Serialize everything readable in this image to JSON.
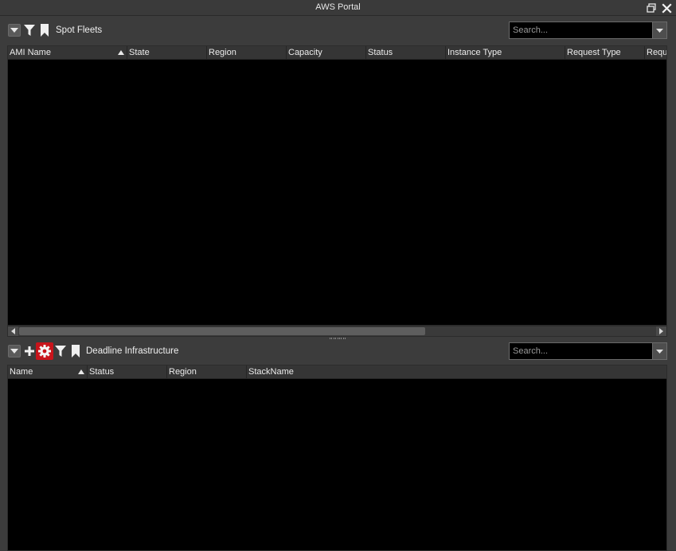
{
  "window": {
    "title": "AWS Portal"
  },
  "spot_fleets": {
    "label": "Spot Fleets",
    "search": {
      "placeholder": "Search...",
      "value": ""
    },
    "columns": [
      "AMI Name",
      "State",
      "Region",
      "Capacity",
      "Status",
      "Instance Type",
      "Request Type",
      "Requ"
    ],
    "sorted_column": "AMI Name",
    "rows": []
  },
  "deadline_infrastructure": {
    "label": "Deadline Infrastructure",
    "search": {
      "placeholder": "Search...",
      "value": ""
    },
    "columns": [
      "Name",
      "Status",
      "Region",
      "StackName"
    ],
    "sorted_column": "Name",
    "rows": []
  },
  "icons": {
    "restore": "restore-window-icon",
    "close": "close-icon",
    "dropdown": "chevron-down-icon",
    "filter": "filter-icon",
    "bookmark": "bookmark-icon",
    "add": "plus-icon",
    "settings": "gear-icon"
  },
  "colors": {
    "background": "#3c3c3c",
    "grid": "#000000",
    "header": "#353535",
    "highlight": "#c8141b",
    "text": "#e6e6e6"
  }
}
